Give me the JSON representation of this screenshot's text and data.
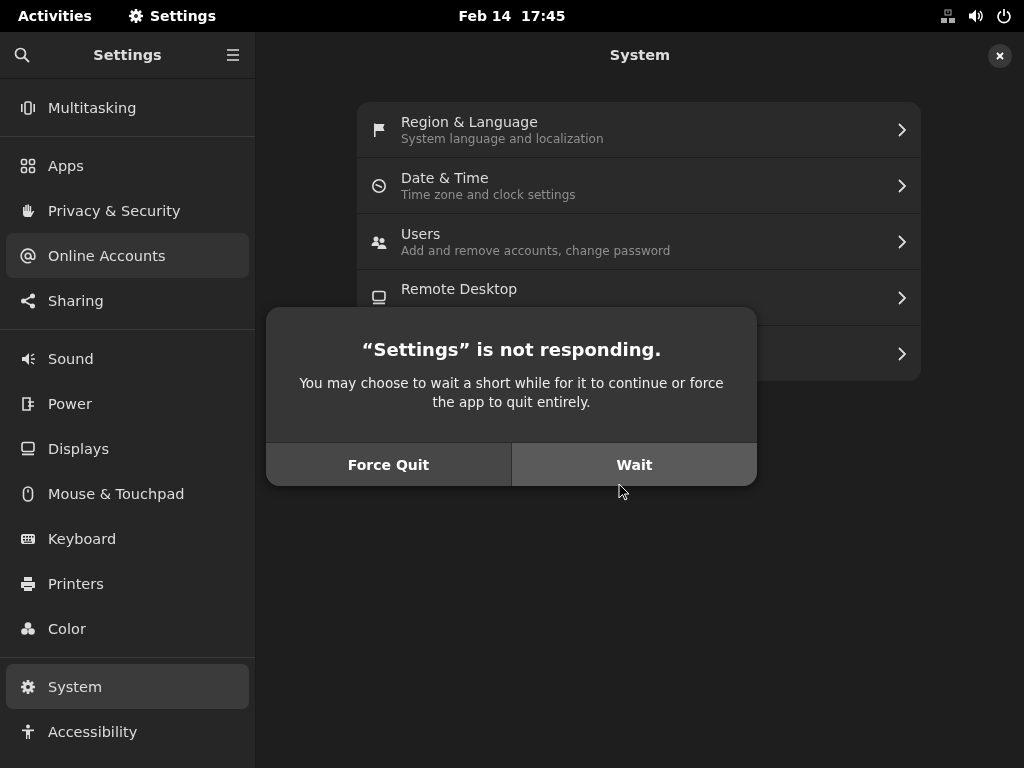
{
  "top_bar": {
    "activities": "Activities",
    "app_name": "Settings",
    "clock": "Feb 14  17:45"
  },
  "sidebar": {
    "title": "Settings",
    "groups": [
      {
        "items": [
          {
            "label": "Multitasking",
            "selected": false,
            "hovered": false
          }
        ]
      },
      {
        "items": [
          {
            "label": "Apps",
            "selected": false,
            "hovered": false
          },
          {
            "label": "Privacy & Security",
            "selected": false,
            "hovered": false
          },
          {
            "label": "Online Accounts",
            "selected": false,
            "hovered": true
          },
          {
            "label": "Sharing",
            "selected": false,
            "hovered": false
          }
        ]
      },
      {
        "items": [
          {
            "label": "Sound",
            "selected": false,
            "hovered": false
          },
          {
            "label": "Power",
            "selected": false,
            "hovered": false
          },
          {
            "label": "Displays",
            "selected": false,
            "hovered": false
          },
          {
            "label": "Mouse & Touchpad",
            "selected": false,
            "hovered": false
          },
          {
            "label": "Keyboard",
            "selected": false,
            "hovered": false
          },
          {
            "label": "Printers",
            "selected": false,
            "hovered": false
          },
          {
            "label": "Color",
            "selected": false,
            "hovered": false
          }
        ]
      },
      {
        "items": [
          {
            "label": "System",
            "selected": true,
            "hovered": false
          },
          {
            "label": "Accessibility",
            "selected": false,
            "hovered": false
          }
        ]
      }
    ]
  },
  "main": {
    "title": "System",
    "rows": [
      {
        "title": "Region & Language",
        "subtitle": "System language and localization"
      },
      {
        "title": "Date & Time",
        "subtitle": "Time zone and clock settings"
      },
      {
        "title": "Users",
        "subtitle": "Add and remove accounts, change password"
      },
      {
        "title": "Remote Desktop"
      },
      {}
    ]
  },
  "dialog": {
    "title": "“Settings” is not responding.",
    "message": "You may choose to wait a short while for it to continue or force the app to quit entirely.",
    "buttons": [
      {
        "label": "Force Quit",
        "hovered": false
      },
      {
        "label": "Wait",
        "hovered": true
      }
    ]
  }
}
